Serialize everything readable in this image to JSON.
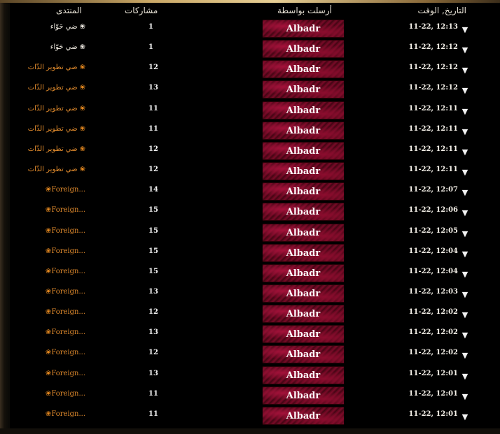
{
  "headers": {
    "date": "التاريخ, الوقت",
    "sender": "أرسلت بواسطة",
    "posts": "مشاركات",
    "forum": "المنتدى"
  },
  "icons": {
    "row_toggle": "triangle-down-icon",
    "forum_bullet": "flower-icon"
  },
  "colors": {
    "forum_white": "#f5f0e6",
    "forum_orange": "#e08a2c",
    "badge_bg": "#55061a"
  },
  "rows": [
    {
      "date": "11-22, 12:13",
      "sender": "Albadr",
      "posts": "1",
      "forum": "ضي حَوّاء",
      "forum_style": "white"
    },
    {
      "date": "11-22, 12:12",
      "sender": "Albadr",
      "posts": "1",
      "forum": "ضي حَوّاء",
      "forum_style": "white"
    },
    {
      "date": "11-22, 12:12",
      "sender": "Albadr",
      "posts": "12",
      "forum": "ضي تطوير الذّات",
      "forum_style": "orange"
    },
    {
      "date": "11-22, 12:12",
      "sender": "Albadr",
      "posts": "13",
      "forum": "ضي تطوير الذّات",
      "forum_style": "orange"
    },
    {
      "date": "11-22, 12:11",
      "sender": "Albadr",
      "posts": "11",
      "forum": "ضي تطوير الذّات",
      "forum_style": "orange"
    },
    {
      "date": "11-22, 12:11",
      "sender": "Albadr",
      "posts": "11",
      "forum": "ضي تطوير الذّات",
      "forum_style": "orange"
    },
    {
      "date": "11-22, 12:11",
      "sender": "Albadr",
      "posts": "12",
      "forum": "ضي تطوير الذّات",
      "forum_style": "orange"
    },
    {
      "date": "11-22, 12:11",
      "sender": "Albadr",
      "posts": "12",
      "forum": "ضي تطوير الذّات",
      "forum_style": "orange"
    },
    {
      "date": "11-22, 12:07",
      "sender": "Albadr",
      "posts": "14",
      "forum": "Foreign...",
      "forum_style": "orange"
    },
    {
      "date": "11-22, 12:06",
      "sender": "Albadr",
      "posts": "15",
      "forum": "Foreign...",
      "forum_style": "orange"
    },
    {
      "date": "11-22, 12:05",
      "sender": "Albadr",
      "posts": "15",
      "forum": "Foreign...",
      "forum_style": "orange"
    },
    {
      "date": "11-22, 12:04",
      "sender": "Albadr",
      "posts": "15",
      "forum": "Foreign...",
      "forum_style": "orange"
    },
    {
      "date": "11-22, 12:04",
      "sender": "Albadr",
      "posts": "15",
      "forum": "Foreign...",
      "forum_style": "orange"
    },
    {
      "date": "11-22, 12:03",
      "sender": "Albadr",
      "posts": "13",
      "forum": "Foreign...",
      "forum_style": "orange"
    },
    {
      "date": "11-22, 12:02",
      "sender": "Albadr",
      "posts": "12",
      "forum": "Foreign...",
      "forum_style": "orange"
    },
    {
      "date": "11-22, 12:02",
      "sender": "Albadr",
      "posts": "13",
      "forum": "Foreign...",
      "forum_style": "orange"
    },
    {
      "date": "11-22, 12:02",
      "sender": "Albadr",
      "posts": "12",
      "forum": "Foreign...",
      "forum_style": "orange"
    },
    {
      "date": "11-22, 12:01",
      "sender": "Albadr",
      "posts": "13",
      "forum": "Foreign...",
      "forum_style": "orange"
    },
    {
      "date": "11-22, 12:01",
      "sender": "Albadr",
      "posts": "11",
      "forum": "Foreign...",
      "forum_style": "orange"
    },
    {
      "date": "11-22, 12:01",
      "sender": "Albadr",
      "posts": "11",
      "forum": "Foreign...",
      "forum_style": "orange"
    }
  ]
}
